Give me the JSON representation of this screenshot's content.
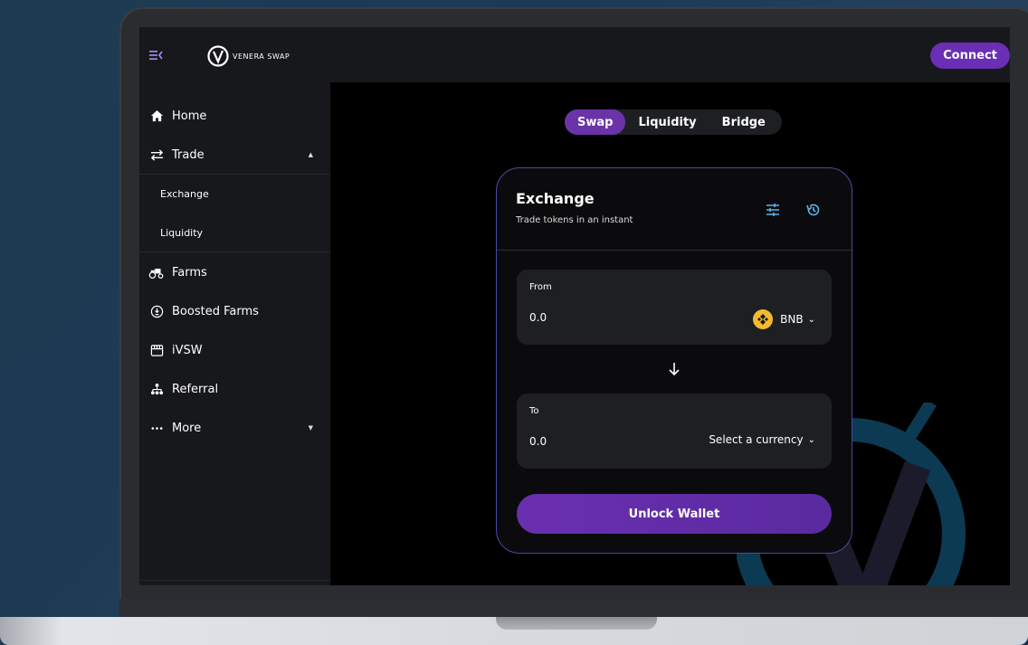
{
  "topbar": {
    "logo_text": "VENERA SWAP",
    "connect_label": "Connect"
  },
  "sidebar": {
    "items": [
      {
        "label": "Home",
        "icon": "home-icon"
      },
      {
        "label": "Trade",
        "icon": "trade-icon"
      },
      {
        "label": "Farms",
        "icon": "tractor-icon"
      },
      {
        "label": "Boosted Farms",
        "icon": "boosted-icon"
      },
      {
        "label": "iVSW",
        "icon": "store-icon"
      },
      {
        "label": "Referral",
        "icon": "referral-icon"
      },
      {
        "label": "More",
        "icon": "more-icon"
      }
    ],
    "trade_sub": [
      "Exchange",
      "Liquidity"
    ]
  },
  "tabs": [
    "Swap",
    "Liquidity",
    "Bridge"
  ],
  "card": {
    "title": "Exchange",
    "subtitle": "Trade tokens in an instant",
    "from": {
      "label": "From",
      "value": "0.0",
      "token": "BNB"
    },
    "to": {
      "label": "To",
      "value": "0.0",
      "token": "Select a currency"
    },
    "unlock_label": "Unlock Wallet"
  },
  "colors": {
    "accent": "#6a2fb4",
    "bnb": "#f3ba2f",
    "icon_blue": "#5ab4e8"
  }
}
